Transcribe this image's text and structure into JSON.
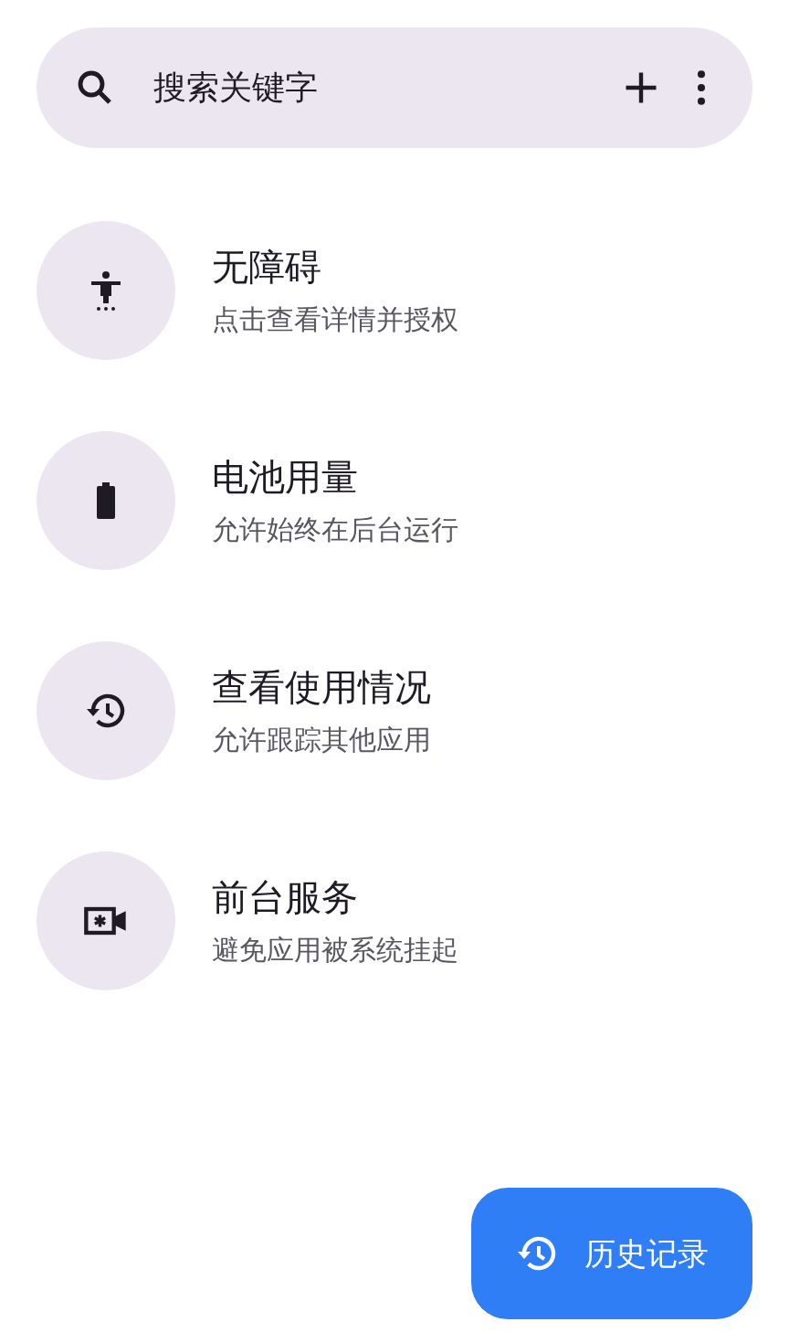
{
  "search": {
    "placeholder": "搜索关键字"
  },
  "items": [
    {
      "kind": "accessibility",
      "title": "无障碍",
      "subtitle": "点击查看详情并授权"
    },
    {
      "kind": "battery",
      "title": "电池用量",
      "subtitle": "允许始终在后台运行"
    },
    {
      "kind": "history",
      "title": "查看使用情况",
      "subtitle": "允许跟踪其他应用"
    },
    {
      "kind": "service",
      "title": "前台服务",
      "subtitle": "避免应用被系统挂起"
    }
  ],
  "fab": {
    "label": "历史记录"
  }
}
